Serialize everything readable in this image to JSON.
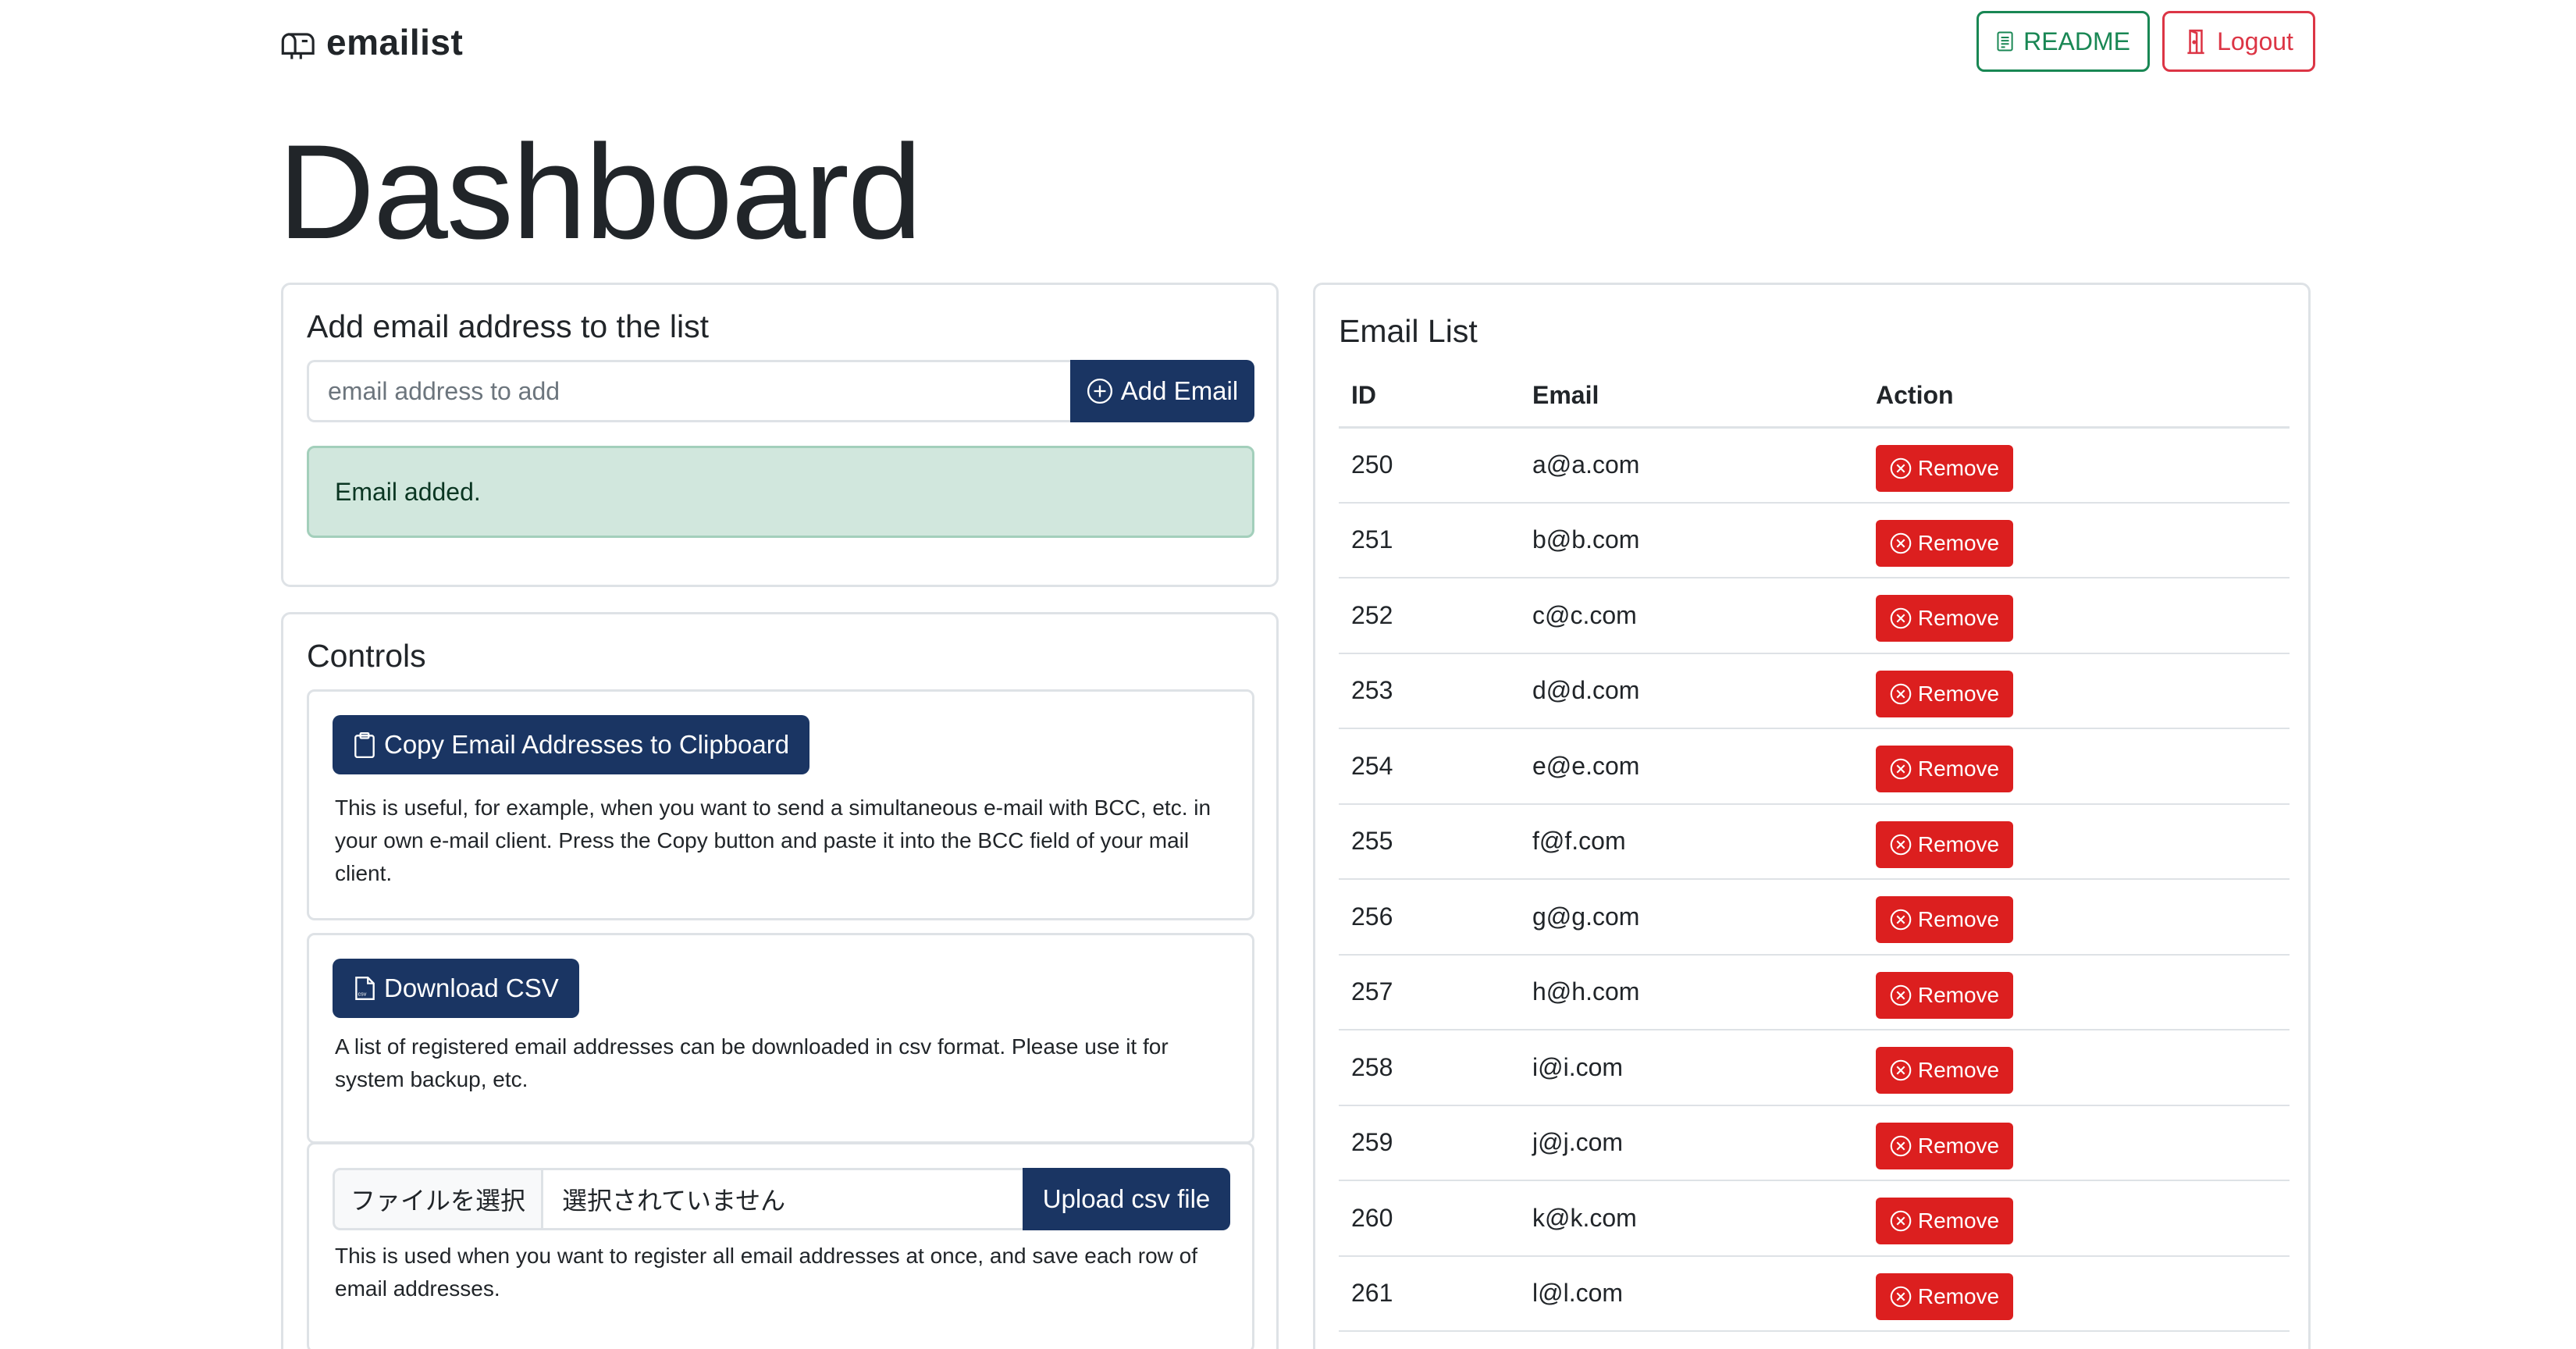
{
  "header": {
    "brand": "emailist",
    "brand_icon": "mailbox-icon",
    "readme_label": "README",
    "logout_label": "Logout"
  },
  "page_title": "Dashboard",
  "add_card": {
    "title": "Add email address to the list",
    "input_placeholder": "email address to add",
    "input_value": "",
    "add_button_label": "Add Email",
    "alert_text": "Email added."
  },
  "controls": {
    "title": "Controls",
    "copy_button_label": "Copy Email Addresses to Clipboard",
    "copy_desc": "This is useful, for example, when you want to send a simultaneous e-mail with BCC, etc. in your own e-mail client. Press the Copy button and paste it into the BCC field of your mail client.",
    "csv_button_label": "Download CSV",
    "csv_desc": "A list of registered email addresses can be downloaded in csv format. Please use it for system backup, etc.",
    "file_choose_label": "ファイルを選択",
    "file_name_text": "選択されていません",
    "upload_button_label": "Upload csv file",
    "upload_desc": "This is used when you want to register all email addresses at once, and save each row of email addresses."
  },
  "email_list": {
    "title": "Email List",
    "columns": [
      "ID",
      "Email",
      "Action"
    ],
    "remove_label": "Remove",
    "rows": [
      {
        "id": "250",
        "email": "a@a.com"
      },
      {
        "id": "251",
        "email": "b@b.com"
      },
      {
        "id": "252",
        "email": "c@c.com"
      },
      {
        "id": "253",
        "email": "d@d.com"
      },
      {
        "id": "254",
        "email": "e@e.com"
      },
      {
        "id": "255",
        "email": "f@f.com"
      },
      {
        "id": "256",
        "email": "g@g.com"
      },
      {
        "id": "257",
        "email": "h@h.com"
      },
      {
        "id": "258",
        "email": "i@i.com"
      },
      {
        "id": "259",
        "email": "j@j.com"
      },
      {
        "id": "260",
        "email": "k@k.com"
      },
      {
        "id": "261",
        "email": "l@l.com"
      }
    ]
  },
  "colors": {
    "primary_navy": "#1a3563",
    "success_green": "#198754",
    "danger_red": "#dc3545",
    "remove_red": "#dc1f1f",
    "alert_bg": "#d1e7dd"
  }
}
